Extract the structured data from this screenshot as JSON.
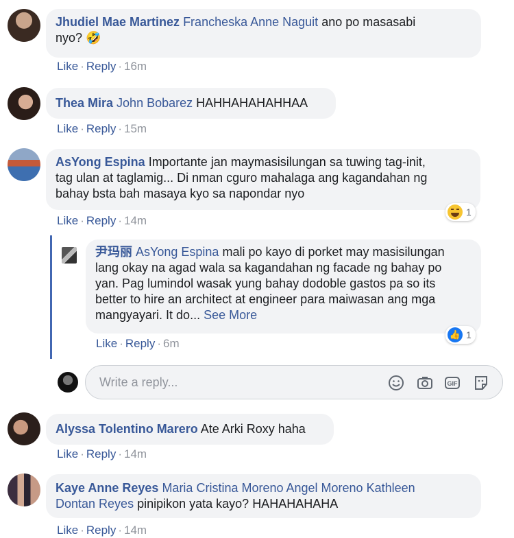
{
  "comments": [
    {
      "name": "Jhudiel Mae Martinez",
      "tag": "Francheska Anne Naguit",
      "text": " ano po masasabi",
      "text2": "nyo? ",
      "emoji": "🤣",
      "like": "Like",
      "reply": "Reply",
      "time": "16m"
    },
    {
      "name": "Thea Mira",
      "tag": "John Bobarez",
      "text": " HAHHAHAHAHHAA",
      "like": "Like",
      "reply": "Reply",
      "time": "15m"
    },
    {
      "name": "AsYong Espina",
      "text": " Importante jan maymasisilungan sa tuwing tag-init,",
      "line2": "tag ulan at taglamig... Di nman cguro mahalaga ang kagandahan ng",
      "line3": "bahay bsta bah masaya kyo sa napondar nyo",
      "like": "Like",
      "reply": "Reply",
      "time": "14m",
      "reaction_icon": "haha-icon",
      "reaction_count": "1"
    },
    {
      "name": "Alyssa Tolentino Marero",
      "text": " Ate Arki Roxy haha",
      "like": "Like",
      "reply": "Reply",
      "time": "14m"
    },
    {
      "name": "Kaye Anne Reyes",
      "tag": "Maria Cristina Moreno Angel Moreno Kathleen",
      "tag2": "Dontan Reyes",
      "text": " pinipikon yata kayo? HAHAHAHAHA",
      "like": "Like",
      "reply": "Reply",
      "time": "14m"
    }
  ],
  "reply": {
    "name": "尹玛丽",
    "tag": "AsYong Espina",
    "text": " mali po kayo di porket may masisilungan",
    "line2": "lang okay na agad wala sa kagandahan ng facade ng bahay po",
    "line3": "yan. Pag lumindol wasak yung bahay dodoble gastos pa so its",
    "line4": "better to hire an architect at engineer para maiwasan ang mga",
    "line5": "mangyayari. It do... ",
    "see_more": "See More",
    "like": "Like",
    "reply": "Reply",
    "time": "6m",
    "reaction_icon": "like-icon",
    "reaction_count": "1"
  },
  "composer": {
    "placeholder": "Write a reply...",
    "tools": [
      "smiley-icon",
      "camera-icon",
      "gif-icon",
      "sticker-icon"
    ]
  },
  "colors": {
    "link": "#385898",
    "bubble": "#f2f3f5",
    "meta": "#90949c",
    "thread": "#4267b2"
  }
}
